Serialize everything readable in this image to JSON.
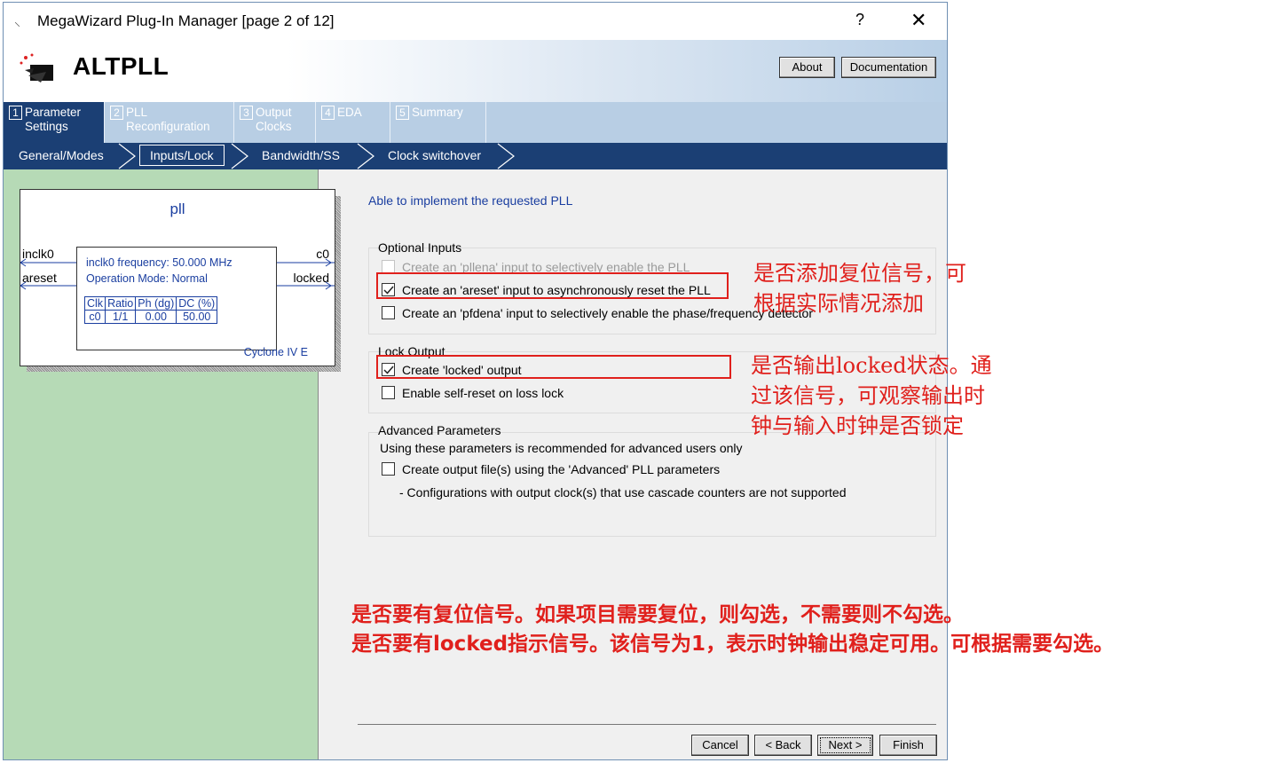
{
  "window": {
    "title": "MegaWizard Plug-In Manager [page 2 of 12]",
    "help": "?",
    "close": "✕"
  },
  "header": {
    "app_name": "ALTPLL",
    "about": "About",
    "documentation": "Documentation"
  },
  "tabs": [
    {
      "num": "1",
      "line1": "Parameter",
      "line2": "Settings"
    },
    {
      "num": "2",
      "line1": "PLL",
      "line2": "Reconfiguration"
    },
    {
      "num": "3",
      "line1": "Output",
      "line2": "Clocks"
    },
    {
      "num": "4",
      "line1": "EDA",
      "line2": ""
    },
    {
      "num": "5",
      "line1": "Summary",
      "line2": ""
    }
  ],
  "subtabs": [
    "General/Modes",
    "Inputs/Lock",
    "Bandwidth/SS",
    "Clock switchover"
  ],
  "diagram": {
    "title": "pll",
    "ports_in": [
      "inclk0",
      "areset"
    ],
    "ports_out": [
      "c0",
      "locked"
    ],
    "info1": "inclk0 frequency: 50.000 MHz",
    "info2": "Operation Mode: Normal",
    "table_headers": [
      "Clk",
      "Ratio",
      "Ph (dg)",
      "DC (%)"
    ],
    "table_row": [
      "c0",
      "1/1",
      "0.00",
      "50.00"
    ],
    "device": "Cyclone IV E"
  },
  "status": "Able to implement the requested PLL",
  "optional_inputs": {
    "label": "Optional Inputs",
    "items": [
      "Create an 'pllena' input to selectively enable the PLL",
      "Create an 'areset' input to asynchronously reset the PLL",
      "Create an 'pfdena' input to selectively enable the phase/frequency detector"
    ]
  },
  "lock_output": {
    "label": "Lock Output",
    "items": [
      "Create 'locked' output",
      "Enable self-reset on loss lock"
    ]
  },
  "advanced": {
    "label": "Advanced Parameters",
    "note": "Using these parameters is recommended for advanced users only",
    "item": "Create output file(s) using the 'Advanced' PLL parameters",
    "sub": "- Configurations with output clock(s) that use cascade counters are not supported"
  },
  "footer": {
    "cancel": "Cancel",
    "back": "< Back",
    "next": "Next >",
    "finish": "Finish"
  },
  "annotations": {
    "a1_l1": "是否添加复位信号，可",
    "a1_l2": "根据实际情况添加",
    "a2_l1": "是否输出locked状态。通",
    "a2_l2": "过该信号，可观察输出时",
    "a2_l3": "钟与输入时钟是否锁定",
    "b_l1": "是否要有复位信号。如果项目需要复位，则勾选，不需要则不勾选。",
    "b_l2": "是否要有locked指示信号。该信号为1，表示时钟输出稳定可用。可根据需要勾选。"
  },
  "colors": {
    "tab_active": "#1b3f74",
    "tabs_bg": "#b8cee4",
    "left_pane": "#b6dab6",
    "annotation": "#e0201c",
    "status_blue": "#1a3ea0"
  }
}
